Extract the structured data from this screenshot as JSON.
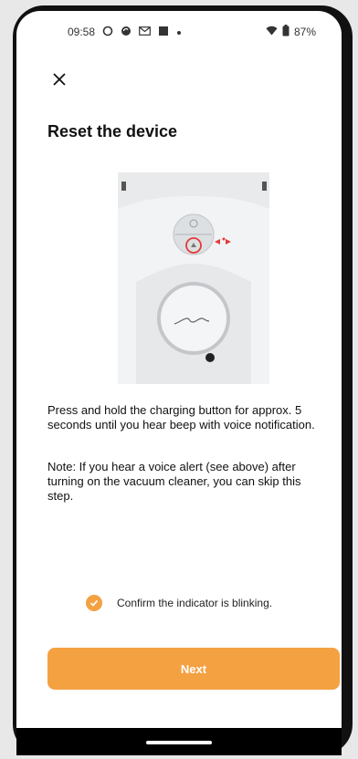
{
  "status": {
    "time": "09:58",
    "battery": "87%",
    "icons": [
      "ring-icon",
      "sync-icon",
      "mail-icon",
      "square-icon",
      "dot-icon"
    ]
  },
  "screen": {
    "title": "Reset the device",
    "description": "Press and hold the charging button for approx. 5 seconds until you hear beep with voice notification.",
    "note": "Note: If you hear a voice alert (see above) after turning on the vacuum cleaner, you can skip this step.",
    "confirm_label": "Confirm the indicator is blinking.",
    "next_label": "Next",
    "illustration_step": "1",
    "illustration_logo": "eru"
  },
  "colors": {
    "accent": "#f4a142",
    "highlight": "#e23a3a"
  }
}
